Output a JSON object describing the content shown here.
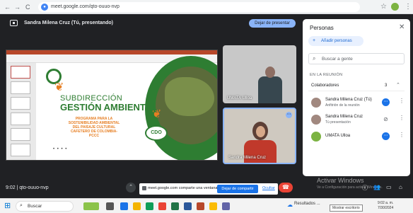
{
  "browser": {
    "back": "←",
    "forward": "→",
    "reload": "C",
    "url": "meet.google.com/qto-ouuo-nvp"
  },
  "presenting": {
    "text": "Sandra Milena Cruz (Tú, presentando)",
    "stop_label": "Dejar de presentar"
  },
  "slide": {
    "title_line1": "SUBDIRECCIÓN",
    "title_line2": "GESTIÓN AMBIENTAL",
    "body": "PROGRAMA PARA LA SOSTENIBILIDAD AMBIENTAL DEL PAISAJE CULTURAL CAFETERO DE COLOMBIA-PCCC",
    "logo": "CDO",
    "dots": "• • • •"
  },
  "tiles": [
    {
      "name": "UMATA Ulloa"
    },
    {
      "name": "Sandra Milena Cruz"
    }
  ],
  "panel": {
    "title": "Personas",
    "close": "✕",
    "add_label": "Añadir personas",
    "search_placeholder": "Buscar a gente",
    "section": "EN LA REUNIÓN",
    "collab_label": "Colaboradores",
    "collab_count": "3",
    "people": [
      {
        "name": "Sandra Milena Cruz (Tú)",
        "sub": "Anfitrión de la reunión"
      },
      {
        "name": "Sandra Milena Cruz",
        "sub": "Tú presentación"
      },
      {
        "name": "UMATA Ulloa",
        "sub": ""
      }
    ]
  },
  "bottom": {
    "meet_code": "9:02 | qto-ouuo-nvp",
    "share_notice": "meet.google.com comparte una ventana.",
    "stop_share": "Dejar de compartir",
    "hide": "Ocultar",
    "activate_title": "Activar Windows",
    "activate_sub": "Ve a Configuración para activar Windows."
  },
  "taskbar": {
    "search_placeholder": "Buscar",
    "weather": "Resultados ...",
    "time": "9:02 a. m.",
    "date": "7/30/2024",
    "tooltip": "Mostrar escritorio"
  }
}
